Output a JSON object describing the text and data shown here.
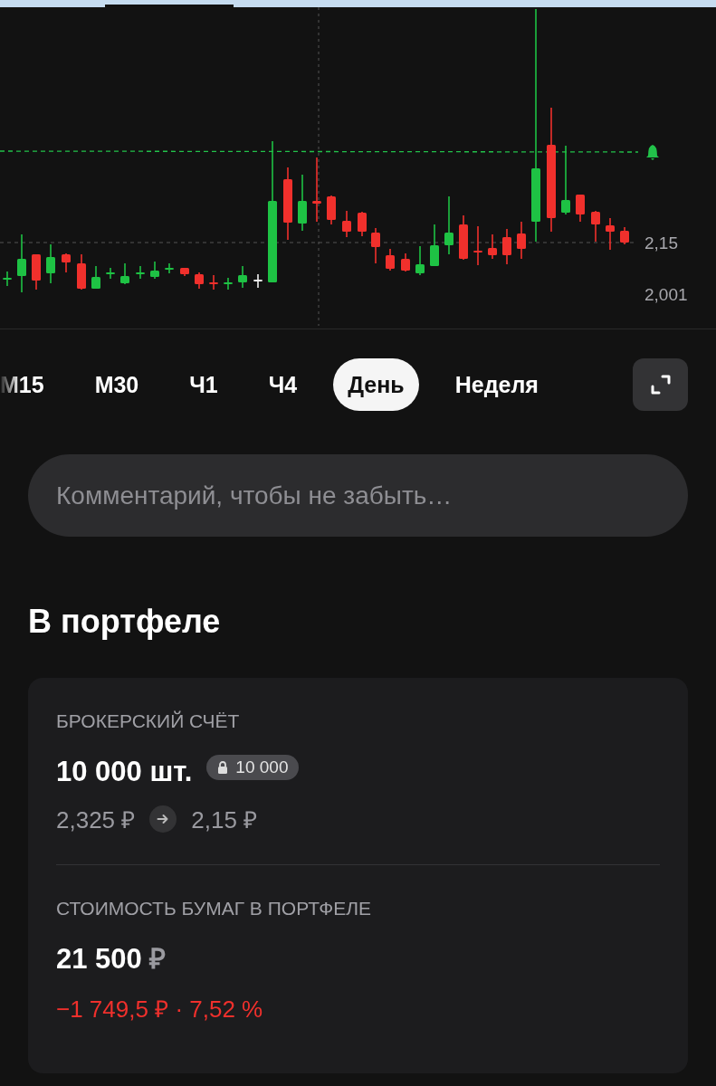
{
  "chart": {
    "price_labels": [
      "2,15",
      "2,001"
    ]
  },
  "timeframes": [
    {
      "label": "M15",
      "selected": false
    },
    {
      "label": "M30",
      "selected": false
    },
    {
      "label": "Ч1",
      "selected": false
    },
    {
      "label": "Ч4",
      "selected": false
    },
    {
      "label": "День",
      "selected": true
    },
    {
      "label": "Неделя",
      "selected": false
    }
  ],
  "comment": {
    "placeholder": "Комментарий, чтобы не забыть…"
  },
  "portfolio": {
    "title": "В портфеле",
    "account": {
      "label": "БРОКЕРСКИЙ СЧЁТ",
      "quantity": "10 000 шт.",
      "blocked": "10 000",
      "price_from": "2,325 ₽",
      "price_to": "2,15 ₽"
    },
    "value": {
      "label": "СТОИМОСТЬ БУМАГ В ПОРТФЕЛЕ",
      "amount": "21 500",
      "currency": "₽",
      "change": "−1 749,5 ₽ · 7,52 %",
      "change_negative": true
    }
  }
}
